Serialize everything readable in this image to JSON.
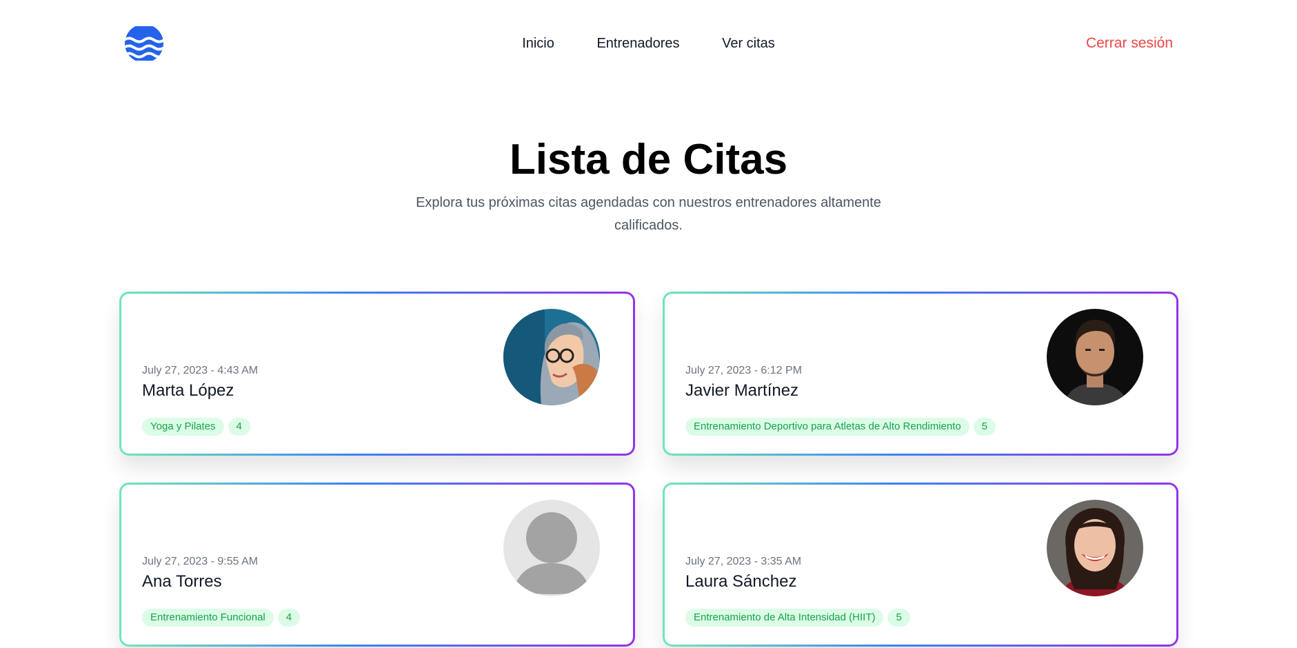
{
  "nav": {
    "logo_icon": "wave-logo-icon",
    "links": [
      "Inicio",
      "Entrenadores",
      "Ver citas"
    ],
    "logout": "Cerrar sesión",
    "accent_color": "#2563eb",
    "logout_color": "#ef4444"
  },
  "hero": {
    "title": "Lista de Citas",
    "subtitle": "Explora tus próximas citas agendadas con nuestros entrenadores altamente calificados."
  },
  "appointments": [
    {
      "date": "July 27, 2023 - 4:43 AM",
      "name": "Marta López",
      "specialty": "Yoga y Pilates",
      "rating": "4",
      "avatar": "trainer-photo"
    },
    {
      "date": "July 27, 2023 - 6:12 PM",
      "name": "Javier Martínez",
      "specialty": "Entrenamiento Deportivo para Atletas de Alto Rendimiento",
      "rating": "5",
      "avatar": "trainer-photo"
    },
    {
      "date": "July 27, 2023 - 9:55 AM",
      "name": "Ana Torres",
      "specialty": "Entrenamiento Funcional",
      "rating": "4",
      "avatar": "default-avatar-icon"
    },
    {
      "date": "July 27, 2023 - 3:35 AM",
      "name": "Laura Sánchez",
      "specialty": "Entrenamiento de Alta Intensidad (HIIT)",
      "rating": "5",
      "avatar": "trainer-photo"
    }
  ]
}
